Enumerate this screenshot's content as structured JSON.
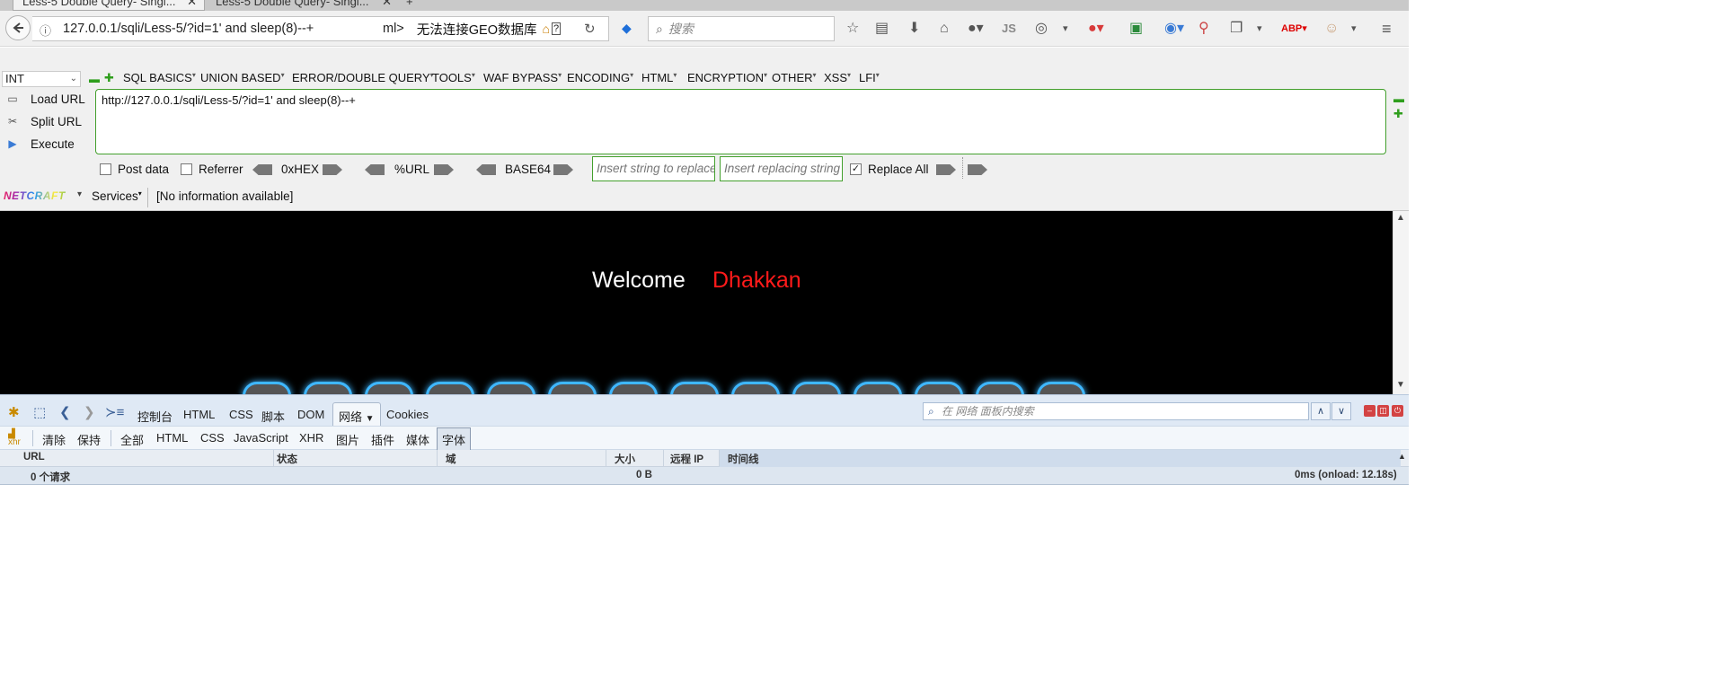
{
  "tabs": [
    {
      "label": "Less-5 Double Query- Singl...",
      "active": true
    },
    {
      "label": "Less-5 Double Query- Singl...",
      "active": false
    }
  ],
  "nav": {
    "url": "127.0.0.1/sqli/Less-5/?id=1' and sleep(8)--+",
    "url_suffix": "ml>",
    "geo_text": "无法连接GEO数据库",
    "search_placeholder": "搜索"
  },
  "hackbar": {
    "int_select": "INT",
    "menus": [
      "SQL BASICS",
      "UNION BASED",
      "ERROR/DOUBLE QUERY",
      "TOOLS",
      "WAF BYPASS",
      "ENCODING",
      "HTML",
      "ENCRYPTION",
      "OTHER",
      "XSS",
      "LFI"
    ],
    "load_url": "Load URL",
    "split_url": "Split URL",
    "execute": "Execute",
    "url_value": "http://127.0.0.1/sqli/Less-5/?id=1' and sleep(8)--+",
    "post_data": "Post data",
    "referrer": "Referrer",
    "hex": "0xHEX",
    "url_enc": "%URL",
    "base64": "BASE64",
    "insert_replace_placeholder": "Insert string to replace",
    "insert_replacing_placeholder": "Insert replacing string",
    "replace_all": "Replace All",
    "replace_all_checked": true
  },
  "netcraft": {
    "logo": "NETCRAFT",
    "services": "Services",
    "info": "[No information available]"
  },
  "page": {
    "welcome": "Welcome",
    "name": "Dhakkan"
  },
  "devtools": {
    "tabs": [
      "控制台",
      "HTML",
      "CSS",
      "脚本",
      "DOM",
      "网络",
      "Cookies"
    ],
    "selected_tab": "网络",
    "search_placeholder": "在 网络 面板内搜索",
    "filters": [
      "清除",
      "保持",
      "全部",
      "HTML",
      "CSS",
      "JavaScript",
      "XHR",
      "图片",
      "插件",
      "媒体",
      "字体"
    ],
    "selected_filter": "字体",
    "columns": [
      "URL",
      "状态",
      "域",
      "大小",
      "远程 IP",
      "时间线"
    ],
    "summary": {
      "requests": "0 个请求",
      "size": "0 B",
      "timing": "0ms (onload: 12.18s)"
    }
  }
}
